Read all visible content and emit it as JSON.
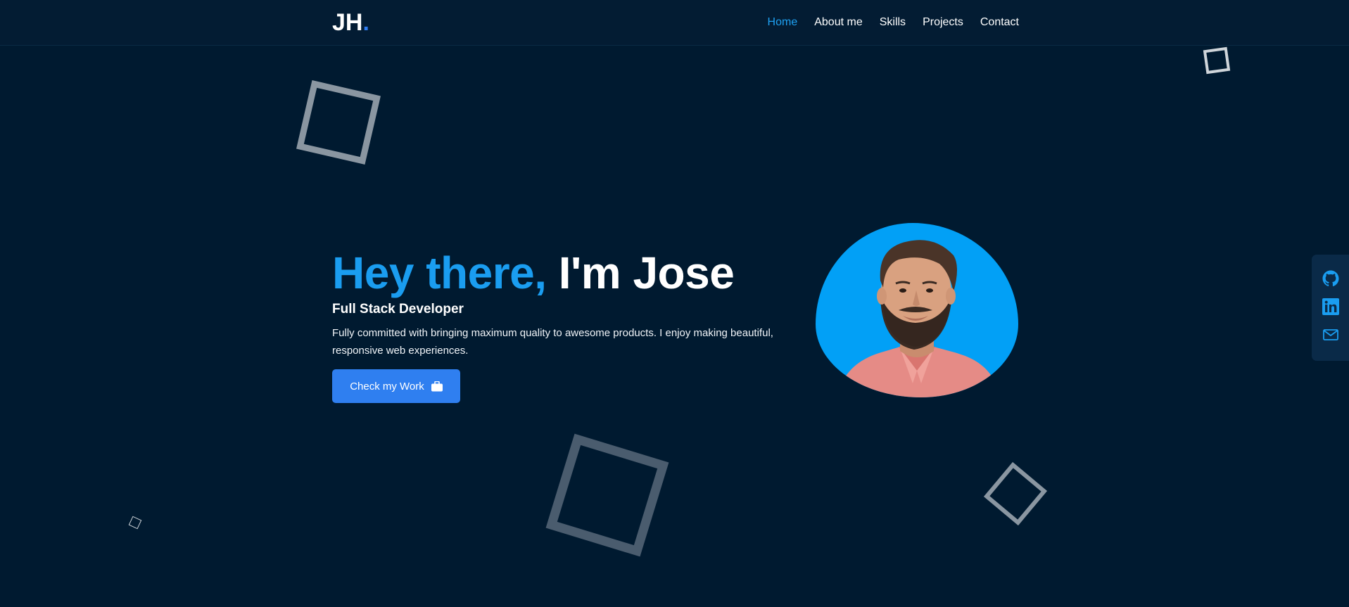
{
  "header": {
    "logo_text": "JH",
    "logo_dot": ".",
    "nav": [
      {
        "label": "Home",
        "active": true
      },
      {
        "label": "About me",
        "active": false
      },
      {
        "label": "Skills",
        "active": false
      },
      {
        "label": "Projects",
        "active": false
      },
      {
        "label": "Contact",
        "active": false
      }
    ]
  },
  "hero": {
    "title_highlight": "Hey there,",
    "title_rest": " I'm Jose",
    "role": "Full Stack Developer",
    "description": "Fully committed with bringing maximum quality to awesome products. I enjoy making beautiful, responsive web experiences.",
    "cta_label": "Check my Work",
    "cta_icon": "briefcase-icon",
    "avatar": "profile-photo"
  },
  "social": {
    "icons": [
      "github-icon",
      "linkedin-icon",
      "mail-icon"
    ]
  },
  "colors": {
    "background": "#001a30",
    "header": "#031c33",
    "accent": "#1a9df0",
    "button": "#2f7ff0",
    "avatar_bg": "#02a0f6"
  }
}
